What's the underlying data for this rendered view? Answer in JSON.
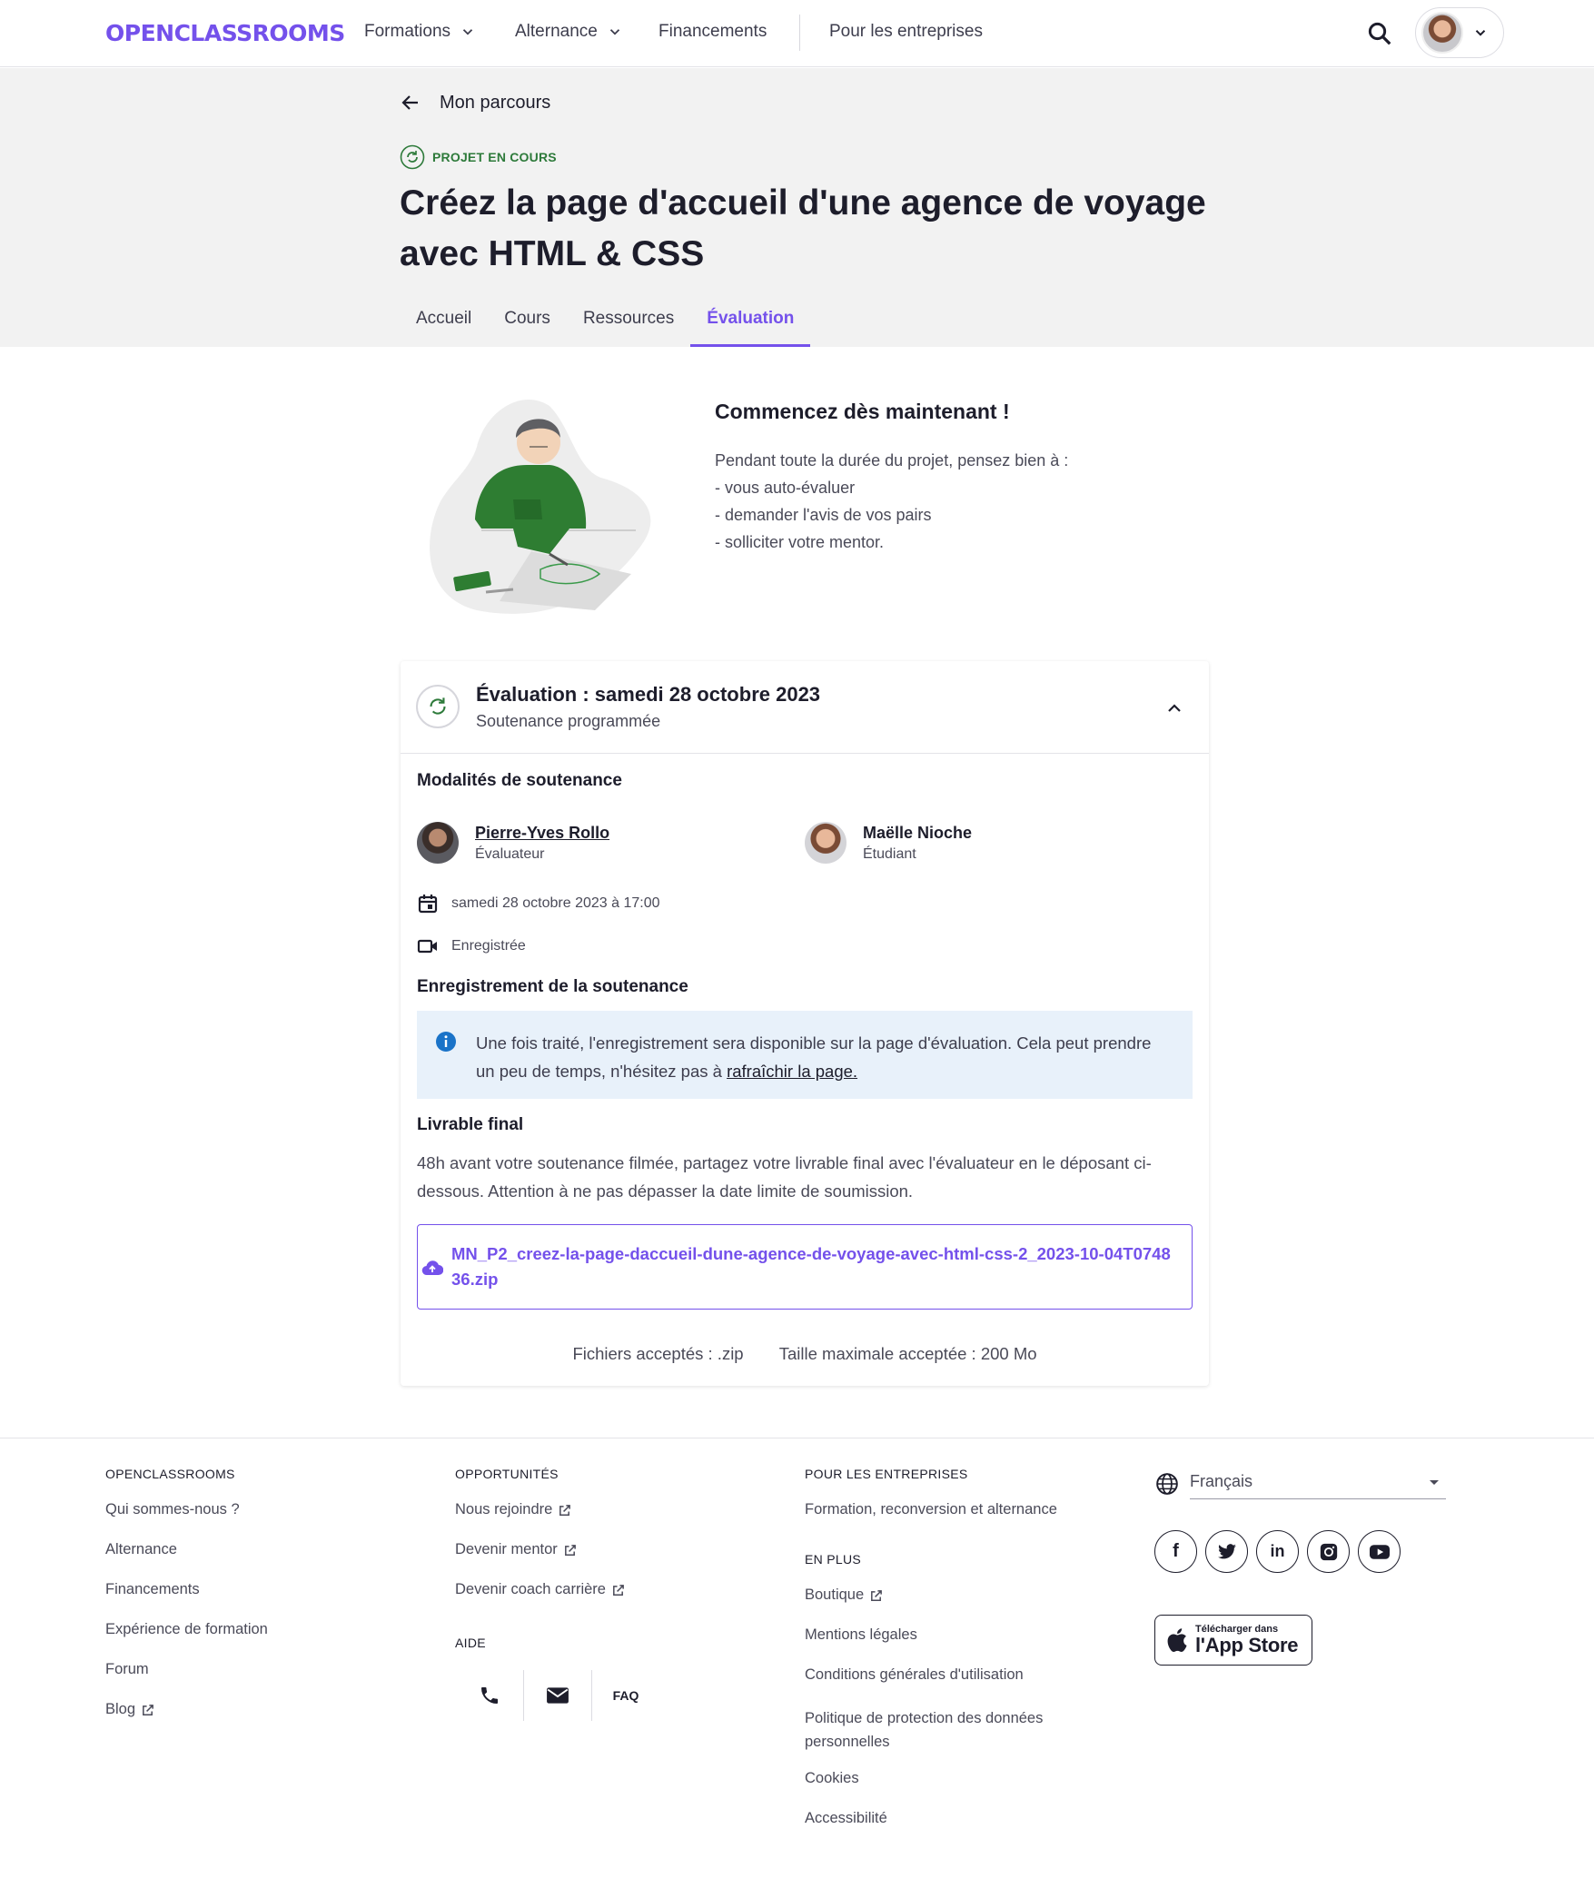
{
  "header": {
    "logo": "OPENCLASSROOMS",
    "nav": [
      {
        "label": "Formations",
        "has_menu": true
      },
      {
        "label": "Alternance",
        "has_menu": true
      },
      {
        "label": "Financements",
        "has_menu": false
      },
      {
        "label": "Pour les entreprises",
        "has_menu": false
      }
    ]
  },
  "hero": {
    "back_label": "Mon parcours",
    "badge": "PROJET EN COURS",
    "title": "Créez la page d'accueil d'une agence de voyage avec HTML & CSS",
    "tabs": [
      {
        "label": "Accueil",
        "active": false
      },
      {
        "label": "Cours",
        "active": false
      },
      {
        "label": "Ressources",
        "active": false
      },
      {
        "label": "Évaluation",
        "active": true
      }
    ]
  },
  "intro": {
    "title": "Commencez dès maintenant !",
    "lines": [
      "Pendant toute la durée du projet, pensez bien à :",
      "- vous auto-évaluer",
      "- demander l'avis de vos pairs",
      "- solliciter votre mentor."
    ]
  },
  "evaluation": {
    "title": "Évaluation : samedi 28 octobre 2023",
    "status": "Soutenance programmée",
    "modalities_title": "Modalités de soutenance",
    "evaluator": {
      "name": "Pierre-Yves Rollo",
      "role": "Évaluateur"
    },
    "student": {
      "name": "Maëlle Nioche",
      "role": "Étudiant"
    },
    "datetime": "samedi 28 octobre 2023 à 17:00",
    "recorded": "Enregistrée",
    "recording_title": "Enregistrement de la soutenance",
    "recording_info": "Une fois traité, l'enregistrement sera disponible sur la page d'évaluation. Cela peut prendre un peu de temps, n'hésitez pas à",
    "recording_link": "rafraîchir la page.",
    "final_title": "Livrable final",
    "final_text": "48h avant votre soutenance filmée, partagez votre livrable final avec l'évaluateur en le déposant ci-dessous. Attention à ne pas dépasser la date limite de soumission.",
    "file_name": "MN_P2_creez-la-page-daccueil-dune-agence-de-voyage-avec-html-css-2_2023-10-04T074836.zip",
    "accepted_files": "Fichiers acceptés : .zip",
    "max_size": "Taille maximale acceptée : 200 Mo"
  },
  "footer": {
    "col1": {
      "head": "OPENCLASSROOMS",
      "links": [
        {
          "label": "Qui sommes-nous ?",
          "external": false
        },
        {
          "label": "Alternance",
          "external": false
        },
        {
          "label": "Financements",
          "external": false
        },
        {
          "label": "Expérience de formation",
          "external": false
        },
        {
          "label": "Forum",
          "external": false
        },
        {
          "label": "Blog",
          "external": true
        }
      ]
    },
    "col2": {
      "head": "OPPORTUNITÉS",
      "links": [
        {
          "label": "Nous rejoindre",
          "external": true
        },
        {
          "label": "Devenir mentor",
          "external": true
        },
        {
          "label": "Devenir coach carrière",
          "external": true
        }
      ],
      "help_head": "AIDE",
      "faq": "FAQ"
    },
    "col3": {
      "head": "POUR LES ENTREPRISES",
      "links": [
        {
          "label": "Formation, reconversion et alternance",
          "external": false
        }
      ],
      "more_head": "EN PLUS",
      "more_links": [
        {
          "label": "Boutique",
          "external": true
        },
        {
          "label": "Mentions légales",
          "external": false
        },
        {
          "label": "Conditions générales d'utilisation",
          "external": false
        },
        {
          "label": "Politique de protection des données personnelles",
          "external": false
        },
        {
          "label": "Cookies",
          "external": false
        },
        {
          "label": "Accessibilité",
          "external": false
        }
      ]
    },
    "language": "Français",
    "socials": [
      "facebook-icon",
      "twitter-icon",
      "linkedin-icon",
      "instagram-icon",
      "youtube-icon"
    ],
    "appstore_small": "Télécharger dans",
    "appstore_big": "l'App Store"
  },
  "colors": {
    "accent": "#7451eb",
    "success": "#2d7a3a",
    "info_bg": "#e8f1fa",
    "hero_bg": "#f2f2f2"
  }
}
